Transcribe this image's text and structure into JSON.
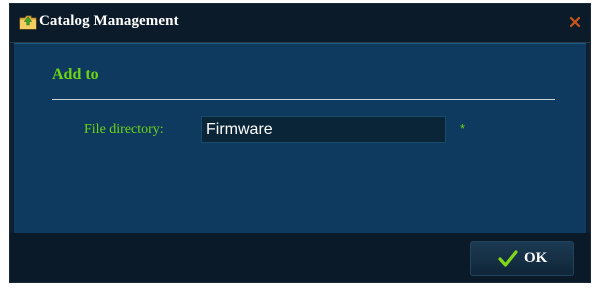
{
  "window": {
    "title": "Catalog Management",
    "title_icon": "folder-upload-icon",
    "close_icon": "close-icon"
  },
  "form": {
    "section_title": "Add to",
    "file_directory_label": "File directory:",
    "file_directory_value": "Firmware",
    "required_mark": "*"
  },
  "footer": {
    "ok_label": "OK",
    "ok_icon": "checkmark-icon"
  },
  "colors": {
    "accent_green": "#6fd414",
    "content_bg": "#0d3a5e",
    "frame_bg": "#0f1f2f",
    "close_orange": "#c8561a"
  }
}
